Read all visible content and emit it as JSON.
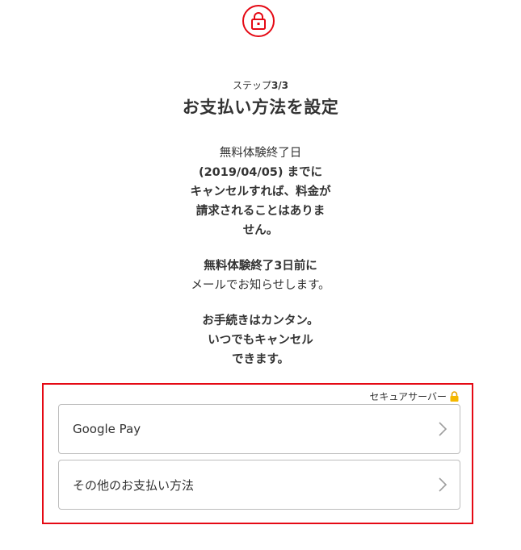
{
  "header": {
    "icon": "lock-icon",
    "accent_color": "#e50914"
  },
  "step": {
    "prefix": "ステップ",
    "value": "3/3"
  },
  "title": "お支払い方法を設定",
  "trial_notice": {
    "line1": "無料体験終了日",
    "line2": "(2019/04/05) までに",
    "line3": "キャンセルすれば、料金が",
    "line4": "請求されることはありま",
    "line5": "せん。"
  },
  "email_notice": {
    "line1": "無料体験終了3日前に",
    "line2": "メールでお知らせします。"
  },
  "easy_notice": {
    "line1": "お手続きはカンタン。",
    "line2": "いつでもキャンセル",
    "line3": "できます。"
  },
  "payment": {
    "secure_label": "セキュアサーバー",
    "secure_icon": "padlock-icon",
    "options": [
      {
        "label": "Google Pay"
      },
      {
        "label": "その他のお支払い方法"
      }
    ]
  }
}
